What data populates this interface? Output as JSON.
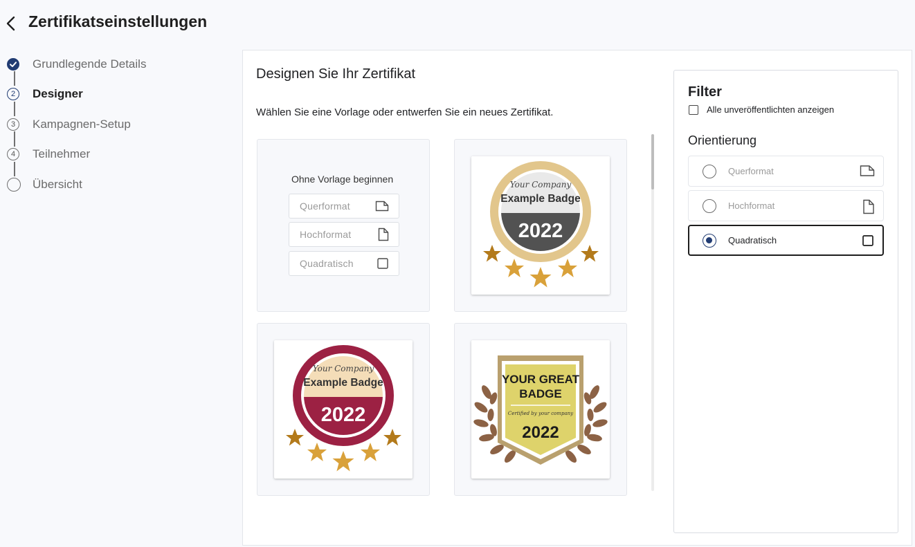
{
  "header": {
    "title": "Zertifikatseinstellungen"
  },
  "stepper": [
    {
      "label": "Grundlegende Details",
      "number": "",
      "state": "done"
    },
    {
      "label": "Designer",
      "number": "2",
      "state": "active"
    },
    {
      "label": "Kampagnen-Setup",
      "number": "3",
      "state": "pending"
    },
    {
      "label": "Teilnehmer",
      "number": "4",
      "state": "pending"
    },
    {
      "label": "Übersicht",
      "number": "",
      "state": "pending"
    }
  ],
  "main": {
    "heading": "Designen Sie Ihr Zertifikat",
    "subheading": "Wählen Sie eine Vorlage oder entwerfen Sie ein neues Zertifikat.",
    "blank_tile": {
      "title": "Ohne Vorlage beginnen",
      "options": [
        "Querformat",
        "Hochformat",
        "Quadratisch"
      ]
    },
    "templates": [
      {
        "company": "Your Company",
        "title": "Example Badge",
        "year": "2022",
        "colors": {
          "ring": "#e2c68c",
          "top": "#e9e9e9",
          "bottom": "#525252",
          "star_dark": "#b37a1b",
          "star_light": "#d9a13a"
        }
      },
      {
        "company": "Your Company",
        "title": "Example Badge",
        "year": "2022",
        "colors": {
          "ring": "#9c2143",
          "top": "#f4ddb8",
          "bottom": "#9c2143",
          "star_dark": "#b37a1b",
          "star_light": "#d9a13a"
        }
      },
      {
        "title_line1": "YOUR GREAT",
        "title_line2": "BADGE",
        "tagline": "Certified by your company",
        "year": "2022",
        "colors": {
          "frame": "#b9a06e",
          "fill": "#ded36b",
          "laurel": "#8c6245"
        }
      }
    ]
  },
  "filter": {
    "title": "Filter",
    "unpublished_label": "Alle unveröffentlichten anzeigen",
    "unpublished_checked": false,
    "orientation_title": "Orientierung",
    "options": [
      {
        "label": "Querformat",
        "icon": "landscape-page-icon",
        "selected": false
      },
      {
        "label": "Hochformat",
        "icon": "portrait-page-icon",
        "selected": false
      },
      {
        "label": "Quadratisch",
        "icon": "square-page-icon",
        "selected": true
      }
    ]
  },
  "theme": {
    "accent": "#213c73",
    "background": "#f8f9fc"
  }
}
